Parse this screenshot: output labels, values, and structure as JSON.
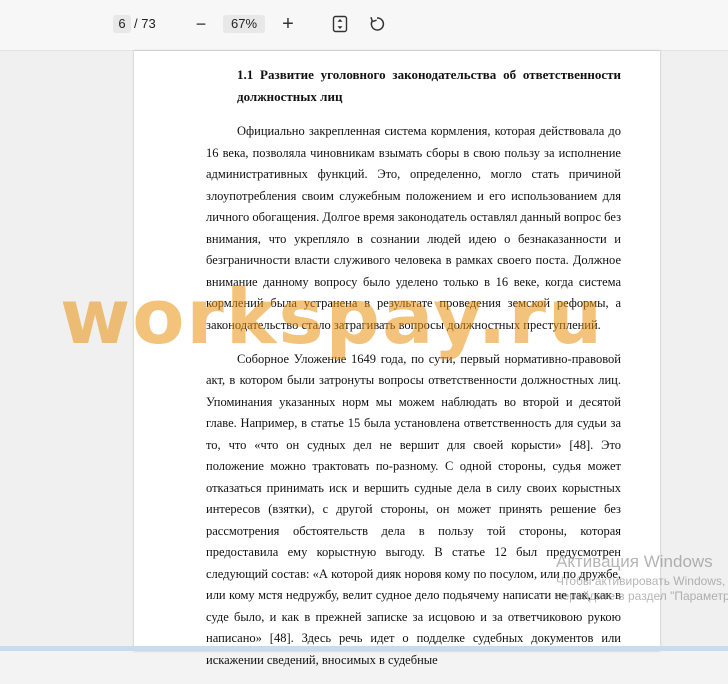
{
  "toolbar": {
    "current_page": "6",
    "total_pages": "/ 73",
    "zoom": "67%",
    "zoom_out_icon": "minus-icon",
    "zoom_in_icon": "plus-icon",
    "fit_icon": "fit-page-icon",
    "rotate_icon": "rotate-icon"
  },
  "document": {
    "heading": "1.1 Развитие уголовного законодательства об ответственности должностных лиц",
    "paragraphs": [
      "Официально закрепленная система кормления, которая действовала до 16 века, позволяла чиновникам взымать сборы в свою пользу за исполнение административных функций. Это, определенно, могло стать причиной злоупотребления своим служебным положением и его использованием для личного обогащения. Долгое время законодатель оставлял данный вопрос без внимания, что укрепляло в сознании людей идею о безнаказанности и безграничности власти служивого человека в рамках своего поста. Должное внимание данному вопросу было уделено только в 16 веке, когда система кормлений была устранена в результате проведения земской реформы, а законодательство стало затрагивать вопросы должностных преступлений.",
      "Соборное Уложение 1649 года, по сути, первый нормативно-правовой акт, в котором были затронуты вопросы ответственности должностных лиц. Упоминания указанных норм мы можем наблюдать во второй и десятой главе. Например, в статье 15 была установлена ответственность для судьи за то, что «что он судных дел не вершит для своей корысти» [48]. Это положение можно трактовать по-разному. С одной стороны, судья может отказаться принимать иск и вершить судные дела в силу своих корыстных интересов (взятки), с другой стороны, он может принять решение без рассмотрения обстоятельств дела в пользу той стороны, которая предоставила ему корыстную выгоду. В статье 12 был предусмотрен следующий состав: «А которой дияк норовя кому по посулом, или по дружбе, или кому мстя недружбу, велит судное дело подьячему написати не так, как в суде было, и как в прежней записке за исцовою и за ответчиковою рукою написано» [48]. Здесь речь идет о подделке судебных документов или искажении сведений, вносимых в судебные"
    ]
  },
  "watermark": "workspay.ru",
  "activation": {
    "title": "Активация Windows",
    "subtitle_1": "Чтобы активировать Windows, перейдите в раздел \"Параметры\"."
  },
  "colors": {
    "watermark": "#eb910f",
    "toolbar_bg": "#f7f7f7",
    "page_bg": "#ffffff"
  }
}
